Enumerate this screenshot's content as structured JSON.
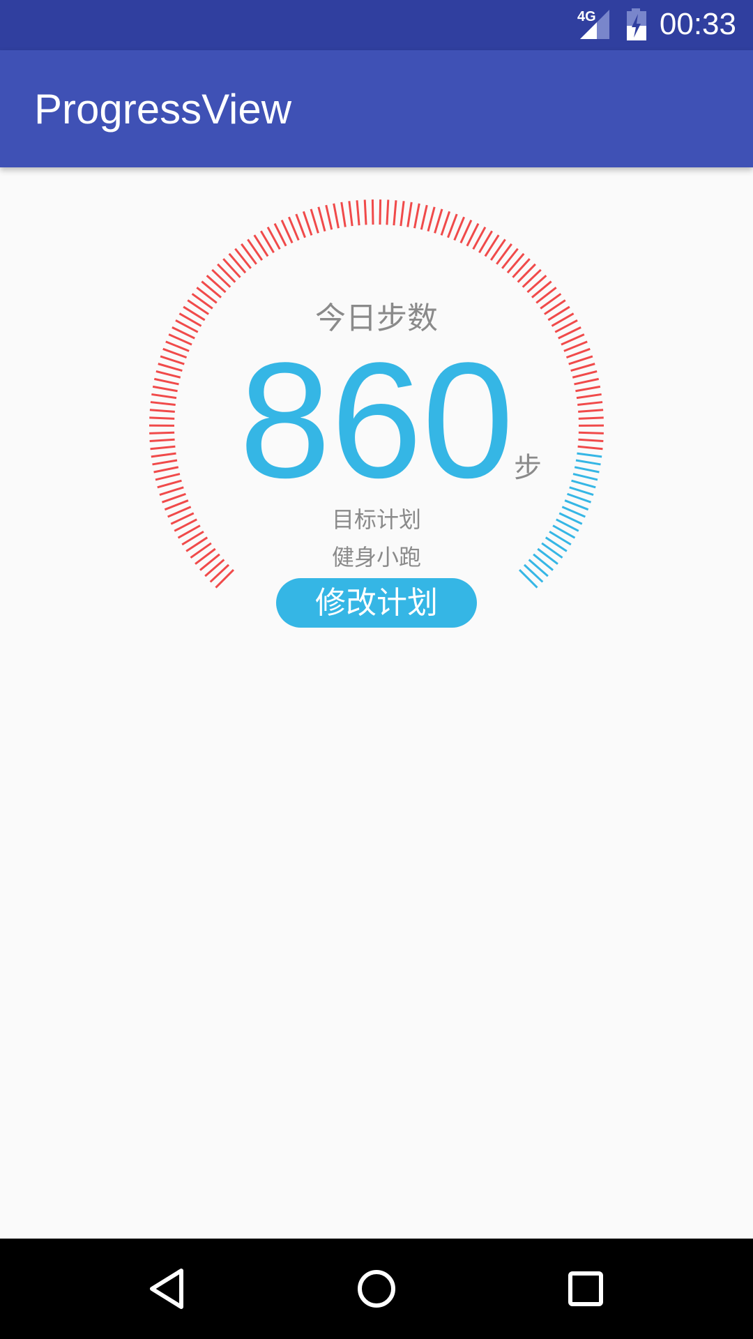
{
  "status_bar": {
    "network": "4G",
    "time": "00:33",
    "icons": [
      "signal-icon",
      "battery-charging-icon"
    ]
  },
  "app_bar": {
    "title": "ProgressView"
  },
  "gauge": {
    "label": "今日步数",
    "steps": "860",
    "unit": "步",
    "goal_label": "目标计划",
    "goal_name": "健身小跑",
    "progress": 0.86,
    "colors": {
      "done": "#F04A4A",
      "remaining": "#35B6E5"
    }
  },
  "edit_button": {
    "label": "修改计划"
  },
  "nav_bar": {
    "icons": [
      "back-icon",
      "home-icon",
      "recents-icon"
    ]
  }
}
